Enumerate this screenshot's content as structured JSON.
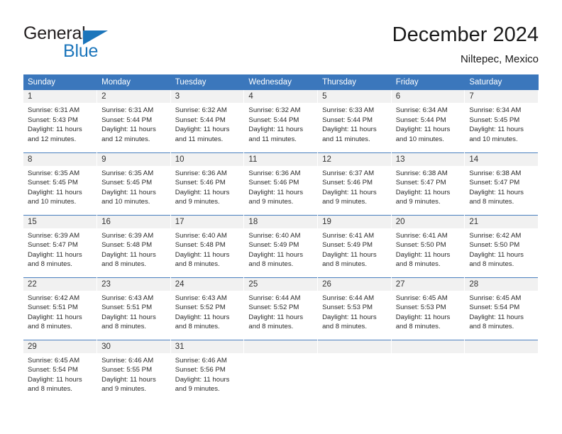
{
  "brand": {
    "name_top": "General",
    "name_bottom": "Blue",
    "accent_color": "#1b75bb"
  },
  "header": {
    "title": "December 2024",
    "subtitle": "Niltepec, Mexico"
  },
  "calendar": {
    "header_bg": "#3b77bc",
    "daynum_bg": "#f1f1f1",
    "weekday_headers": [
      "Sunday",
      "Monday",
      "Tuesday",
      "Wednesday",
      "Thursday",
      "Friday",
      "Saturday"
    ],
    "weeks": [
      [
        {
          "day": "1",
          "sunrise": "Sunrise: 6:31 AM",
          "sunset": "Sunset: 5:43 PM",
          "daylight1": "Daylight: 11 hours",
          "daylight2": "and 12 minutes."
        },
        {
          "day": "2",
          "sunrise": "Sunrise: 6:31 AM",
          "sunset": "Sunset: 5:44 PM",
          "daylight1": "Daylight: 11 hours",
          "daylight2": "and 12 minutes."
        },
        {
          "day": "3",
          "sunrise": "Sunrise: 6:32 AM",
          "sunset": "Sunset: 5:44 PM",
          "daylight1": "Daylight: 11 hours",
          "daylight2": "and 11 minutes."
        },
        {
          "day": "4",
          "sunrise": "Sunrise: 6:32 AM",
          "sunset": "Sunset: 5:44 PM",
          "daylight1": "Daylight: 11 hours",
          "daylight2": "and 11 minutes."
        },
        {
          "day": "5",
          "sunrise": "Sunrise: 6:33 AM",
          "sunset": "Sunset: 5:44 PM",
          "daylight1": "Daylight: 11 hours",
          "daylight2": "and 11 minutes."
        },
        {
          "day": "6",
          "sunrise": "Sunrise: 6:34 AM",
          "sunset": "Sunset: 5:44 PM",
          "daylight1": "Daylight: 11 hours",
          "daylight2": "and 10 minutes."
        },
        {
          "day": "7",
          "sunrise": "Sunrise: 6:34 AM",
          "sunset": "Sunset: 5:45 PM",
          "daylight1": "Daylight: 11 hours",
          "daylight2": "and 10 minutes."
        }
      ],
      [
        {
          "day": "8",
          "sunrise": "Sunrise: 6:35 AM",
          "sunset": "Sunset: 5:45 PM",
          "daylight1": "Daylight: 11 hours",
          "daylight2": "and 10 minutes."
        },
        {
          "day": "9",
          "sunrise": "Sunrise: 6:35 AM",
          "sunset": "Sunset: 5:45 PM",
          "daylight1": "Daylight: 11 hours",
          "daylight2": "and 10 minutes."
        },
        {
          "day": "10",
          "sunrise": "Sunrise: 6:36 AM",
          "sunset": "Sunset: 5:46 PM",
          "daylight1": "Daylight: 11 hours",
          "daylight2": "and 9 minutes."
        },
        {
          "day": "11",
          "sunrise": "Sunrise: 6:36 AM",
          "sunset": "Sunset: 5:46 PM",
          "daylight1": "Daylight: 11 hours",
          "daylight2": "and 9 minutes."
        },
        {
          "day": "12",
          "sunrise": "Sunrise: 6:37 AM",
          "sunset": "Sunset: 5:46 PM",
          "daylight1": "Daylight: 11 hours",
          "daylight2": "and 9 minutes."
        },
        {
          "day": "13",
          "sunrise": "Sunrise: 6:38 AM",
          "sunset": "Sunset: 5:47 PM",
          "daylight1": "Daylight: 11 hours",
          "daylight2": "and 9 minutes."
        },
        {
          "day": "14",
          "sunrise": "Sunrise: 6:38 AM",
          "sunset": "Sunset: 5:47 PM",
          "daylight1": "Daylight: 11 hours",
          "daylight2": "and 8 minutes."
        }
      ],
      [
        {
          "day": "15",
          "sunrise": "Sunrise: 6:39 AM",
          "sunset": "Sunset: 5:47 PM",
          "daylight1": "Daylight: 11 hours",
          "daylight2": "and 8 minutes."
        },
        {
          "day": "16",
          "sunrise": "Sunrise: 6:39 AM",
          "sunset": "Sunset: 5:48 PM",
          "daylight1": "Daylight: 11 hours",
          "daylight2": "and 8 minutes."
        },
        {
          "day": "17",
          "sunrise": "Sunrise: 6:40 AM",
          "sunset": "Sunset: 5:48 PM",
          "daylight1": "Daylight: 11 hours",
          "daylight2": "and 8 minutes."
        },
        {
          "day": "18",
          "sunrise": "Sunrise: 6:40 AM",
          "sunset": "Sunset: 5:49 PM",
          "daylight1": "Daylight: 11 hours",
          "daylight2": "and 8 minutes."
        },
        {
          "day": "19",
          "sunrise": "Sunrise: 6:41 AM",
          "sunset": "Sunset: 5:49 PM",
          "daylight1": "Daylight: 11 hours",
          "daylight2": "and 8 minutes."
        },
        {
          "day": "20",
          "sunrise": "Sunrise: 6:41 AM",
          "sunset": "Sunset: 5:50 PM",
          "daylight1": "Daylight: 11 hours",
          "daylight2": "and 8 minutes."
        },
        {
          "day": "21",
          "sunrise": "Sunrise: 6:42 AM",
          "sunset": "Sunset: 5:50 PM",
          "daylight1": "Daylight: 11 hours",
          "daylight2": "and 8 minutes."
        }
      ],
      [
        {
          "day": "22",
          "sunrise": "Sunrise: 6:42 AM",
          "sunset": "Sunset: 5:51 PM",
          "daylight1": "Daylight: 11 hours",
          "daylight2": "and 8 minutes."
        },
        {
          "day": "23",
          "sunrise": "Sunrise: 6:43 AM",
          "sunset": "Sunset: 5:51 PM",
          "daylight1": "Daylight: 11 hours",
          "daylight2": "and 8 minutes."
        },
        {
          "day": "24",
          "sunrise": "Sunrise: 6:43 AM",
          "sunset": "Sunset: 5:52 PM",
          "daylight1": "Daylight: 11 hours",
          "daylight2": "and 8 minutes."
        },
        {
          "day": "25",
          "sunrise": "Sunrise: 6:44 AM",
          "sunset": "Sunset: 5:52 PM",
          "daylight1": "Daylight: 11 hours",
          "daylight2": "and 8 minutes."
        },
        {
          "day": "26",
          "sunrise": "Sunrise: 6:44 AM",
          "sunset": "Sunset: 5:53 PM",
          "daylight1": "Daylight: 11 hours",
          "daylight2": "and 8 minutes."
        },
        {
          "day": "27",
          "sunrise": "Sunrise: 6:45 AM",
          "sunset": "Sunset: 5:53 PM",
          "daylight1": "Daylight: 11 hours",
          "daylight2": "and 8 minutes."
        },
        {
          "day": "28",
          "sunrise": "Sunrise: 6:45 AM",
          "sunset": "Sunset: 5:54 PM",
          "daylight1": "Daylight: 11 hours",
          "daylight2": "and 8 minutes."
        }
      ],
      [
        {
          "day": "29",
          "sunrise": "Sunrise: 6:45 AM",
          "sunset": "Sunset: 5:54 PM",
          "daylight1": "Daylight: 11 hours",
          "daylight2": "and 8 minutes."
        },
        {
          "day": "30",
          "sunrise": "Sunrise: 6:46 AM",
          "sunset": "Sunset: 5:55 PM",
          "daylight1": "Daylight: 11 hours",
          "daylight2": "and 9 minutes."
        },
        {
          "day": "31",
          "sunrise": "Sunrise: 6:46 AM",
          "sunset": "Sunset: 5:56 PM",
          "daylight1": "Daylight: 11 hours",
          "daylight2": "and 9 minutes."
        },
        {
          "day": "",
          "sunrise": "",
          "sunset": "",
          "daylight1": "",
          "daylight2": ""
        },
        {
          "day": "",
          "sunrise": "",
          "sunset": "",
          "daylight1": "",
          "daylight2": ""
        },
        {
          "day": "",
          "sunrise": "",
          "sunset": "",
          "daylight1": "",
          "daylight2": ""
        },
        {
          "day": "",
          "sunrise": "",
          "sunset": "",
          "daylight1": "",
          "daylight2": ""
        }
      ]
    ]
  }
}
